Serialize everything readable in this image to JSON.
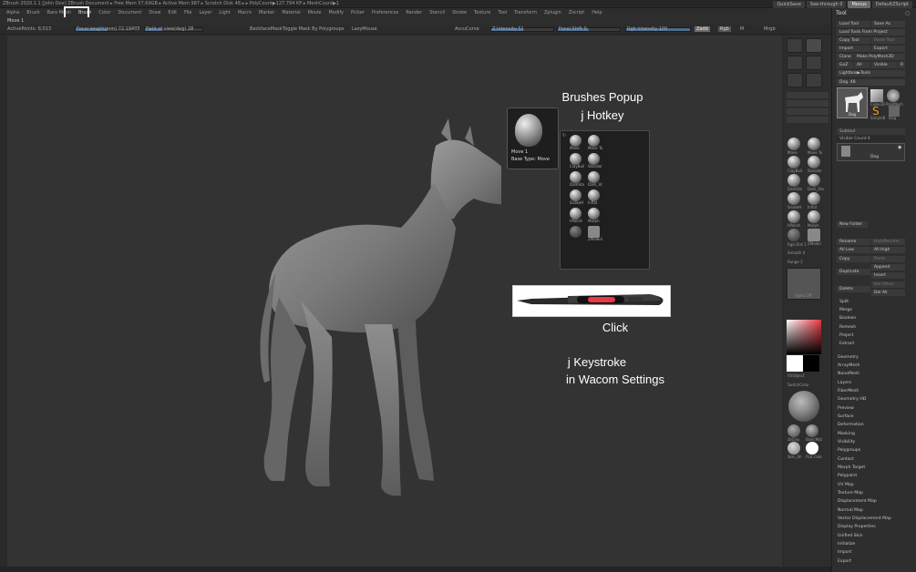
{
  "titlebar": {
    "text": "ZBrush 2020.1.1 [John Doe] ZBrush Document  ▸ Free Mem 57.69GB ▸ Active Mem 987 ▸ Scratch Disk 48 ▸ ▸ PolyCount▶127.794 KP ▸ MeshCount▶1",
    "quicksave": "QuickSave",
    "seethrough": "See-through  0",
    "menus_btn": "Menus",
    "defaultzscript": "DefaultZScript"
  },
  "menubar": [
    "Alpha",
    "Brush",
    "Bare Mesh",
    "Brush",
    "Color",
    "Document",
    "Draw",
    "Edit",
    "File",
    "Layer",
    "Light",
    "Macro",
    "Marker",
    "Material",
    "Movie",
    "Modify",
    "Picker",
    "Preferences",
    "Render",
    "Stencil",
    "Stroke",
    "Texture",
    "Tool",
    "Transform",
    "Zplugin",
    "Zscript",
    "Help"
  ],
  "row2": {
    "label": "Move 1"
  },
  "row3": {
    "activepoints": "ActivePoints: 8,013",
    "focal_length": "Focal length(mm) 72.19405",
    "fov": "Field of view(deg) 28",
    "backfacemask": "BackfaceMask",
    "toggle_mask": "Toggle Mask By Polygroups",
    "lazymouse": "LazyMouse",
    "accucurve": "AccuCurve",
    "z_intensity": "Z Intensity 51",
    "focal_shift": "Focal Shift 0",
    "rgb_intensity": "Rgb Intensity 100",
    "zadd": "Zadd",
    "rgb": "Rgb",
    "m": "M",
    "mrgb": "Mrgb"
  },
  "popup": {
    "name": "Move  1",
    "base_type": "Base Type: Move"
  },
  "brushes": [
    {
      "label": "Move"
    },
    {
      "label": "Move To"
    },
    {
      "label": "ClayBuil"
    },
    {
      "label": "Standar"
    },
    {
      "label": "DamSta"
    },
    {
      "label": "Dam_St"
    },
    {
      "label": "SnakeH"
    },
    {
      "label": "Inflat"
    },
    {
      "label": "hPolish"
    },
    {
      "label": "Morph"
    },
    {
      "label": ""
    },
    {
      "label": "ZModeli"
    }
  ],
  "annotations": {
    "brushes_popup": "Brushes Popup",
    "j_hotkey": "j Hotkey",
    "click": "Click",
    "j_keystroke": "j Keystroke",
    "wacom": "in Wacom Settings"
  },
  "toolstrip": {
    "brushes": [
      "Move",
      "Move To",
      "ClayBuil",
      "Standar",
      "DamSta",
      "Dam_Sta",
      "SnakeH",
      "Inflat",
      "hPolish",
      "Morph",
      "",
      "ZModel"
    ],
    "rgb_dist": "Rgb Dist 1",
    "smooth": "Smooth 0",
    "range": "Range 3",
    "alpha_off": "Alpha Off",
    "fill_object": "FillObject",
    "switch_color": "SwitchColor",
    "matcap": "zbClay",
    "basic_mat": "BasicMat",
    "matcaps": [
      "Skin_Sh",
      "Flat Colo"
    ]
  },
  "rpanel": {
    "header": "Tool",
    "buttons": [
      [
        "Load Tool",
        "Save As"
      ],
      [
        "Load Tools From Project",
        ""
      ],
      [
        "Copy Tool",
        "Paste Tool"
      ],
      [
        "Import",
        "Export"
      ],
      [
        "Clone",
        "Make PolyMesh3D"
      ],
      [
        "GoZ",
        "All",
        "Visible",
        "R"
      ],
      [
        "Lightbox▶Tools",
        ""
      ]
    ],
    "dog_label": "Dog. 48",
    "subtools": [
      "Dog",
      "Cube3D",
      "PolyMesh",
      "SimpleB",
      "Dog"
    ],
    "subtool_header": "Subtool",
    "visible_count": "Visible Count 4",
    "subtool_row": "Dog",
    "newfolder": "New Folder",
    "rename": "Rename",
    "autoreorder": "AutoReorder",
    "all_low": "All Low",
    "all_high": "All High",
    "copy": "Copy",
    "paste": "Paste",
    "append": "Append",
    "duplicate": "Duplicate",
    "insert": "Insert",
    "delete": "Delete",
    "del_other": "Del Other",
    "del_all": "Del All",
    "menus": [
      "Split",
      "Merge",
      "Boolean",
      "Remesh",
      "Project",
      "Extract"
    ],
    "palettes": [
      "Geometry",
      "ArrayMesh",
      "NanoMesh",
      "Layers",
      "FiberMesh",
      "Geometry HD",
      "Preview",
      "Surface",
      "Deformation",
      "Masking",
      "Visibility",
      "Polygroups",
      "Contact",
      "Morph Target",
      "Polypaint",
      "UV Map",
      "Texture Map",
      "Displacement Map",
      "Normal Map",
      "Vector Displacement Map",
      "Display Properties",
      "Unified Skin",
      "Initialize",
      "Import",
      "Export"
    ]
  },
  "colors": {
    "highlight_border": "#ffffff",
    "pen_button": "#e63946",
    "slider_fill": "#4f6e8e"
  }
}
